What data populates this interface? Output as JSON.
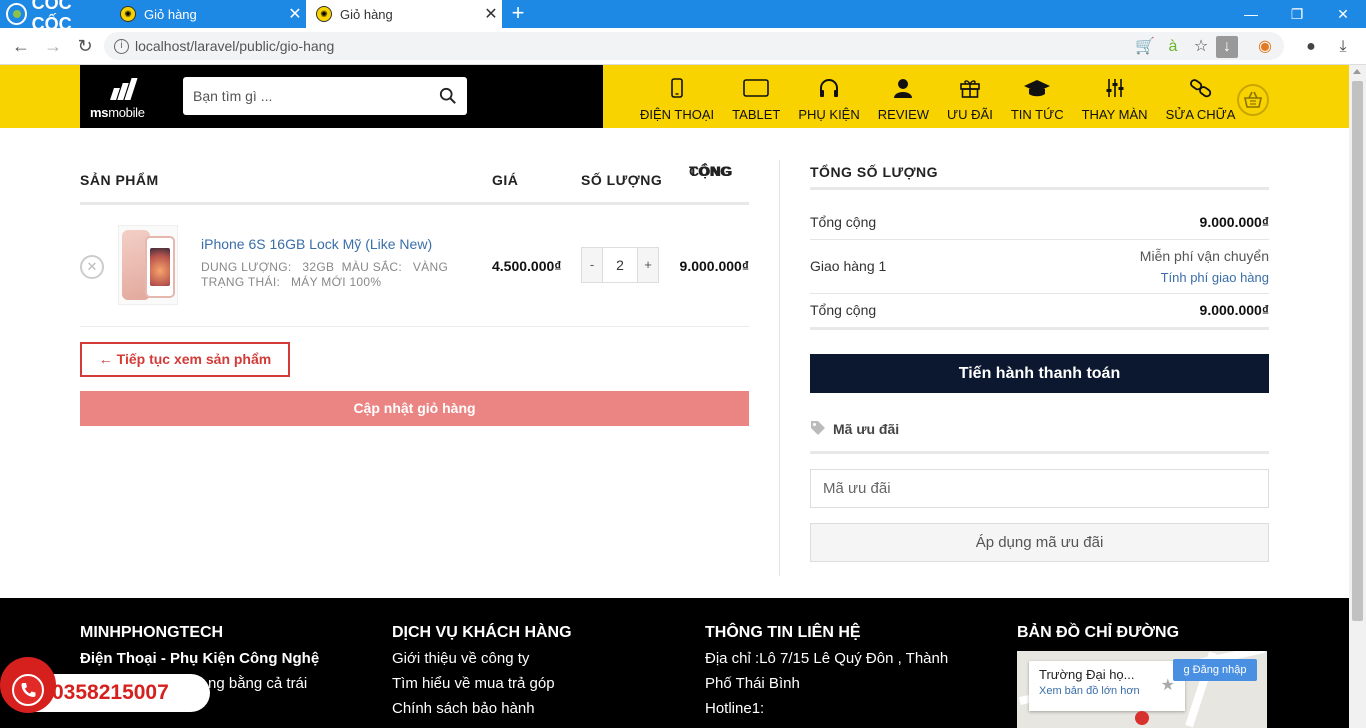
{
  "browser": {
    "brand": "CỐC CỐC",
    "tabs": [
      {
        "title": "Giỏ hàng"
      },
      {
        "title": "Giỏ hàng"
      }
    ],
    "url": "localhost/laravel/public/gio-hang"
  },
  "header": {
    "logo_ms": "ms",
    "logo_mobile": "mobile",
    "search_placeholder": "Bạn tìm gì ...",
    "menu": [
      {
        "label": "ĐIỆN THOẠI",
        "icon": "phone-icon"
      },
      {
        "label": "TABLET",
        "icon": "tablet-icon"
      },
      {
        "label": "PHỤ KIỆN",
        "icon": "headphones-icon"
      },
      {
        "label": "REVIEW",
        "icon": "user-icon"
      },
      {
        "label": "ƯU ĐÃI",
        "icon": "gift-icon"
      },
      {
        "label": "TIN TỨC",
        "icon": "graduation-cap-icon"
      },
      {
        "label": "THAY MÀN",
        "icon": "sliders-icon"
      },
      {
        "label": "SỬA CHỮA",
        "icon": "link-icon"
      }
    ]
  },
  "cart": {
    "headers": {
      "product": "SẢN PHẨM",
      "price": "GIÁ",
      "quantity": "SỐ LƯỢNG",
      "total_line1": "TỔNG",
      "total_line2": "CỘNG"
    },
    "items": [
      {
        "name": "iPhone 6S 16GB Lock Mỹ (Like New)",
        "meta_line1": "DUNG LƯỢNG:   32GB  MÀU SẮC:   VÀNG",
        "meta_line2": "TRẠNG THÁI:   MÁY MỚI 100%",
        "price": "4.500.000₫",
        "quantity": "2",
        "minus": "-",
        "plus": "+",
        "total": "9.000.000₫"
      }
    ],
    "continue_label": "← Tiếp tục xem sản phẩm",
    "update_label": "Cập nhật giỏ hàng"
  },
  "totals": {
    "title": "TỔNG SỐ LƯỢNG",
    "subtotal_label": "Tổng cộng",
    "subtotal_value": "9.000.000₫",
    "shipping_label": "Giao hàng 1",
    "shipping_free": "Miễn phí vận chuyển",
    "shipping_calc": "Tính phí giao hàng",
    "total_label": "Tổng cộng",
    "total_value": "9.000.000₫",
    "checkout_label": "Tiến hành thanh toán",
    "coupon_title": "Mã ưu đãi",
    "coupon_placeholder": "Mã ưu đãi",
    "apply_label": "Áp dụng mã ưu đãi"
  },
  "footer": {
    "col1_title": "MINHPHONGTECH",
    "col1_line1": "Điện Thoại - Phụ Kiện Công Nghệ",
    "col1_line2": "ng bằng cả trái",
    "col2_title": "DỊCH VỤ KHÁCH HÀNG",
    "col2_links": [
      "Giới thiệu về công ty",
      "Tìm hiểu về mua trả góp",
      "Chính sách bảo hành"
    ],
    "col3_title": "THÔNG TIN LIÊN HỆ",
    "col3_line1": "Địa chỉ :Lô 7/15 Lê Quý Đôn , Thành",
    "col3_line2": "Phố Thái Bình",
    "col3_line3": "Hotline1:",
    "col4_title": "BẢN ĐỒ CHỈ ĐƯỜNG",
    "map_place": "Trường Đại họ...",
    "map_link": "Xem bản đồ lớn hơn",
    "map_login": "Đăng nhập",
    "hotline": "0358215007"
  },
  "colors": {
    "header_yellow": "#f9d300",
    "checkout_navy": "#0c1830",
    "update_pink": "#ea8584",
    "continue_red": "#d23b37",
    "link_blue": "#3a6ea8"
  }
}
